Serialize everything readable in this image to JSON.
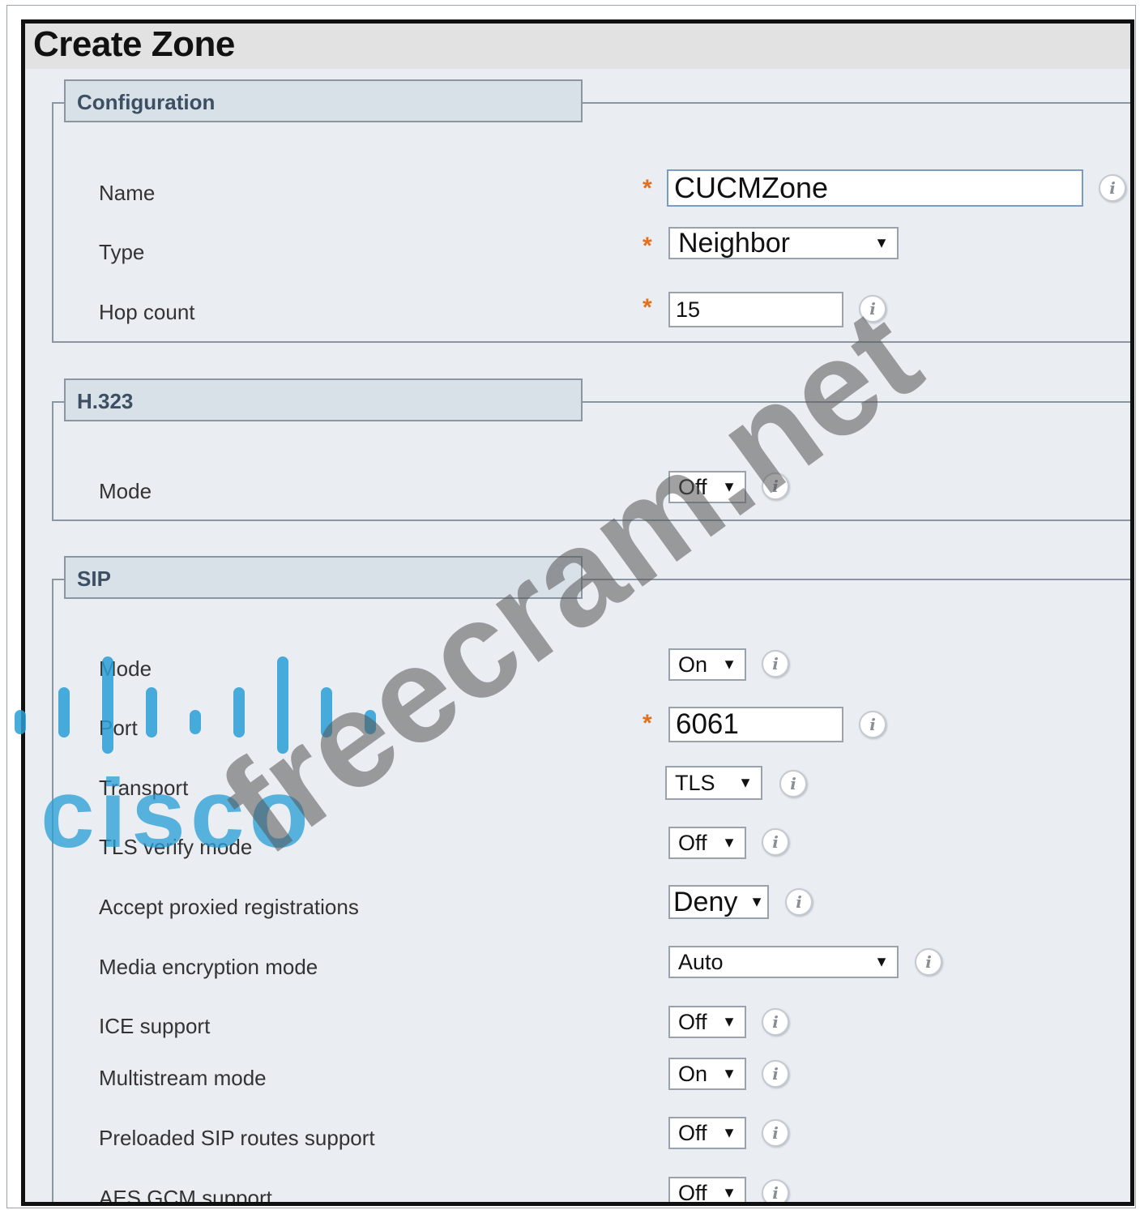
{
  "page": {
    "title": "Create Zone"
  },
  "sections": {
    "configuration": {
      "header": "Configuration",
      "name": {
        "label": "Name",
        "value": "CUCMZone"
      },
      "type": {
        "label": "Type",
        "value": "Neighbor"
      },
      "hop_count": {
        "label": "Hop count",
        "value": "15"
      }
    },
    "h323": {
      "header": "H.323",
      "mode": {
        "label": "Mode",
        "value": "Off"
      }
    },
    "sip": {
      "header": "SIP",
      "mode": {
        "label": "Mode",
        "value": "On"
      },
      "port": {
        "label": "Port",
        "value": "6061"
      },
      "transport": {
        "label": "Transport",
        "value": "TLS"
      },
      "tls_verify_mode": {
        "label": "TLS verify mode",
        "value": "Off"
      },
      "accept_proxied_registrations": {
        "label": "Accept proxied registrations",
        "value": "Deny"
      },
      "media_encryption_mode": {
        "label": "Media encryption mode",
        "value": "Auto"
      },
      "ice_support": {
        "label": "ICE support",
        "value": "Off"
      },
      "multistream_mode": {
        "label": "Multistream mode",
        "value": "On"
      },
      "preloaded_sip_routes_support": {
        "label": "Preloaded SIP routes support",
        "value": "Off"
      },
      "aes_gcm_support": {
        "label": "AES GCM support",
        "value": "Off"
      }
    }
  },
  "symbols": {
    "required": "*",
    "info": "i",
    "dropdown_arrow": "▼"
  },
  "watermark": {
    "logo_text": "cisco",
    "text": "freecram.net"
  },
  "colors": {
    "required": "#e07020",
    "section_header_bg": "#d9e1e8",
    "panel_bg": "#eaeef3",
    "logo": "#2a9fd6"
  }
}
